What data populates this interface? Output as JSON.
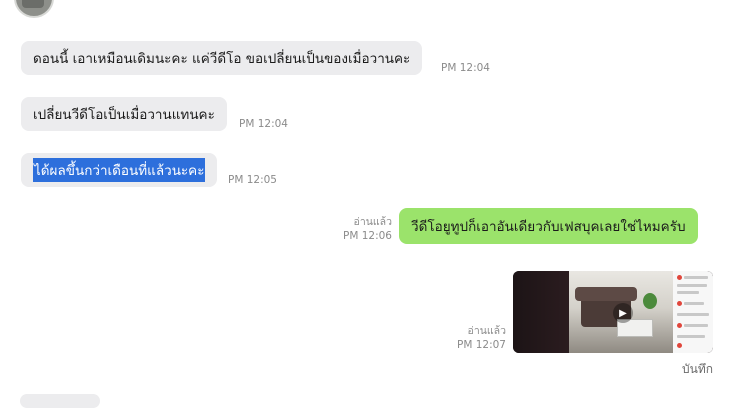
{
  "messages": [
    {
      "direction": "in",
      "text": "ดอนนี้ เอาเหมือนเดิมนะคะ แค่วีดีโอ ขอเปลี่ยนเป็นของเมื่อวานคะ",
      "time": "PM 12:04"
    },
    {
      "direction": "in",
      "text": "เปลี่ยนวีดีโอเป็นเมื่อวานแทนคะ",
      "time": "PM 12:04"
    },
    {
      "direction": "in",
      "text": "ได้ผลขึ้นกว่าเดือนที่แล้วนะคะ",
      "time": "PM 12:05",
      "selected": true
    },
    {
      "direction": "out",
      "text": "วีดีโอยูทูปก็เอาอันเดียวกับเฟสบุคเลยใช่ไหมครับ",
      "read": "อ่านแล้ว",
      "time": "PM 12:06"
    },
    {
      "direction": "out",
      "type": "video",
      "read": "อ่านแล้ว",
      "time": "PM 12:07"
    }
  ],
  "media_actions": {
    "save_label": "บันทึก"
  },
  "colors": {
    "incoming_bubble": "#ececee",
    "outgoing_bubble": "#9be36b",
    "selection": "#2d6fdc"
  }
}
